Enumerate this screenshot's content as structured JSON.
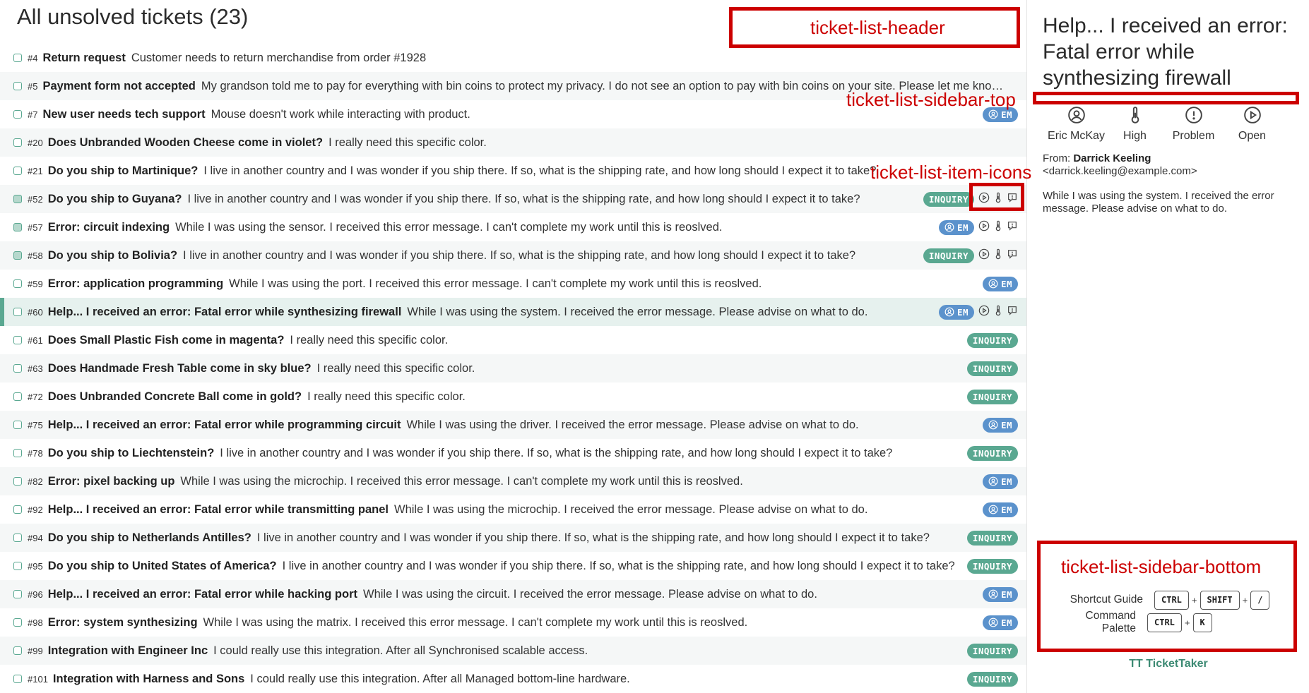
{
  "header": {
    "title": "All unsolved tickets (23)"
  },
  "annotations": {
    "header": "ticket-list-header",
    "sidebar_top": "ticket-list-sidebar-top",
    "item_icons": "ticket-list-item-icons",
    "sidebar_bottom": "ticket-list-sidebar-bottom"
  },
  "tickets": [
    {
      "id": "#4",
      "title": "Return request",
      "desc": "Customer needs to return merchandise from order #1928",
      "badge": "",
      "icons": false,
      "filled": false,
      "selected": false
    },
    {
      "id": "#5",
      "title": "Payment form not accepted",
      "desc": "My grandson told me to pay for everything with bin coins to protect my privacy. I do not see an option to pay with bin coins on your site. Please let me know how ...",
      "badge": "",
      "icons": false,
      "filled": false,
      "selected": false
    },
    {
      "id": "#7",
      "title": "New user needs tech support",
      "desc": "Mouse doesn't work while interacting with product.",
      "badge": "EM",
      "icons": false,
      "filled": false,
      "selected": false
    },
    {
      "id": "#20",
      "title": "Does Unbranded Wooden Cheese come in violet?",
      "desc": "I really need this specific color.",
      "badge": "",
      "icons": false,
      "filled": false,
      "selected": false
    },
    {
      "id": "#21",
      "title": "Do you ship to Martinique?",
      "desc": "I live in another country and I was wonder if you ship there. If so, what is the shipping rate, and how long should I expect it to take?",
      "badge": "",
      "icons": false,
      "filled": false,
      "selected": false
    },
    {
      "id": "#52",
      "title": "Do you ship to Guyana?",
      "desc": "I live in another country and I was wonder if you ship there. If so, what is the shipping rate, and how long should I expect it to take?",
      "badge": "INQUIRY",
      "icons": true,
      "filled": true,
      "selected": false
    },
    {
      "id": "#57",
      "title": "Error: circuit indexing",
      "desc": "While I was using the sensor. I received this error message. I can't complete my work until this is reoslved.",
      "badge": "EM",
      "icons": true,
      "filled": true,
      "selected": false
    },
    {
      "id": "#58",
      "title": "Do you ship to Bolivia?",
      "desc": "I live in another country and I was wonder if you ship there. If so, what is the shipping rate, and how long should I expect it to take?",
      "badge": "INQUIRY",
      "icons": true,
      "filled": true,
      "selected": false
    },
    {
      "id": "#59",
      "title": "Error: application programming",
      "desc": "While I was using the port. I received this error message. I can't complete my work until this is reoslved.",
      "badge": "EM",
      "icons": false,
      "filled": false,
      "selected": false
    },
    {
      "id": "#60",
      "title": "Help... I received an error: Fatal error while synthesizing firewall",
      "desc": "While I was using the system. I received the error message. Please advise on what to do.",
      "badge": "EM",
      "icons": true,
      "filled": false,
      "selected": true
    },
    {
      "id": "#61",
      "title": "Does Small Plastic Fish come in magenta?",
      "desc": "I really need this specific color.",
      "badge": "INQUIRY",
      "icons": false,
      "filled": false,
      "selected": false
    },
    {
      "id": "#63",
      "title": "Does Handmade Fresh Table come in sky blue?",
      "desc": "I really need this specific color.",
      "badge": "INQUIRY",
      "icons": false,
      "filled": false,
      "selected": false
    },
    {
      "id": "#72",
      "title": "Does Unbranded Concrete Ball come in gold?",
      "desc": "I really need this specific color.",
      "badge": "INQUIRY",
      "icons": false,
      "filled": false,
      "selected": false
    },
    {
      "id": "#75",
      "title": "Help... I received an error: Fatal error while programming circuit",
      "desc": "While I was using the driver. I received the error message. Please advise on what to do.",
      "badge": "EM",
      "icons": false,
      "filled": false,
      "selected": false
    },
    {
      "id": "#78",
      "title": "Do you ship to Liechtenstein?",
      "desc": "I live in another country and I was wonder if you ship there. If so, what is the shipping rate, and how long should I expect it to take?",
      "badge": "INQUIRY",
      "icons": false,
      "filled": false,
      "selected": false
    },
    {
      "id": "#82",
      "title": "Error: pixel backing up",
      "desc": "While I was using the microchip. I received this error message. I can't complete my work until this is reoslved.",
      "badge": "EM",
      "icons": false,
      "filled": false,
      "selected": false
    },
    {
      "id": "#92",
      "title": "Help... I received an error: Fatal error while transmitting panel",
      "desc": "While I was using the microchip. I received the error message. Please advise on what to do.",
      "badge": "EM",
      "icons": false,
      "filled": false,
      "selected": false
    },
    {
      "id": "#94",
      "title": "Do you ship to Netherlands Antilles?",
      "desc": "I live in another country and I was wonder if you ship there. If so, what is the shipping rate, and how long should I expect it to take?",
      "badge": "INQUIRY",
      "icons": false,
      "filled": false,
      "selected": false
    },
    {
      "id": "#95",
      "title": "Do you ship to United States of America?",
      "desc": "I live in another country and I was wonder if you ship there. If so, what is the shipping rate, and how long should I expect it to take?",
      "badge": "INQUIRY",
      "icons": false,
      "filled": false,
      "selected": false
    },
    {
      "id": "#96",
      "title": "Help... I received an error: Fatal error while hacking port",
      "desc": "While I was using the circuit. I received the error message. Please advise on what to do.",
      "badge": "EM",
      "icons": false,
      "filled": false,
      "selected": false
    },
    {
      "id": "#98",
      "title": "Error: system synthesizing",
      "desc": "While I was using the matrix. I received this error message. I can't complete my work until this is reoslved.",
      "badge": "EM",
      "icons": false,
      "filled": false,
      "selected": false
    },
    {
      "id": "#99",
      "title": "Integration with Engineer Inc",
      "desc": "I could really use this integration. After all Synchronised scalable access.",
      "badge": "INQUIRY",
      "icons": false,
      "filled": false,
      "selected": false
    },
    {
      "id": "#101",
      "title": "Integration with Harness and Sons",
      "desc": "I could really use this integration. After all Managed bottom-line hardware.",
      "badge": "INQUIRY",
      "icons": false,
      "filled": false,
      "selected": false
    }
  ],
  "sidebar": {
    "title": "Help... I received an error: Fatal error while synthesizing firewall",
    "fields": [
      {
        "icon": "user-icon",
        "label": "Eric McKay"
      },
      {
        "icon": "thermometer-icon",
        "label": "High"
      },
      {
        "icon": "alert-icon",
        "label": "Problem"
      },
      {
        "icon": "play-icon",
        "label": "Open"
      }
    ],
    "from_label": "From:",
    "from_name": "Darrick Keeling",
    "from_email": "<darrick.keeling@example.com>",
    "body": "While I was using the system. I received the error message. Please advise on what to do.",
    "shortcuts": [
      {
        "label": "Shortcut Guide",
        "keys": [
          "CTRL",
          "SHIFT",
          "/"
        ]
      },
      {
        "label": "Command Palette",
        "keys": [
          "CTRL",
          "K"
        ]
      }
    ],
    "brand": "TT TicketTaker"
  },
  "colors": {
    "accent": "#5aa891",
    "em_badge": "#5b92cc",
    "annotation": "#cc0000"
  }
}
